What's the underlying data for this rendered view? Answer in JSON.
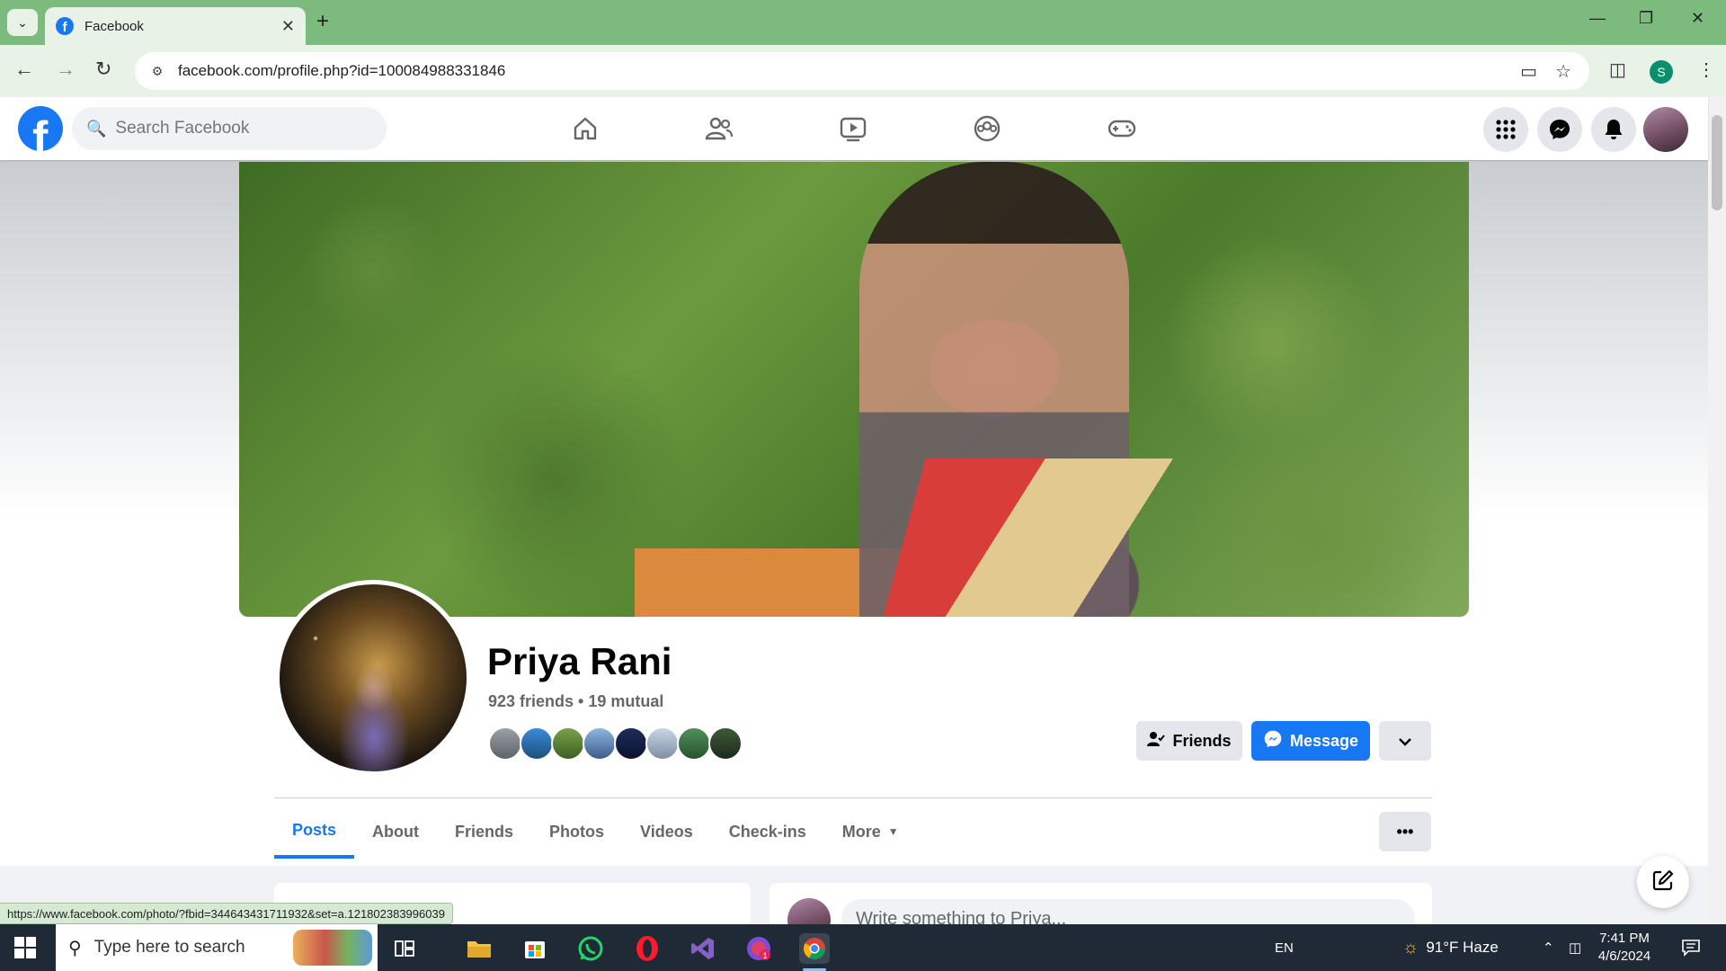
{
  "browser": {
    "tab_title": "Facebook",
    "url": "facebook.com/profile.php?id=100084988331846",
    "profile_initial": "S"
  },
  "facebook": {
    "search_placeholder": "Search Facebook",
    "logo_letter": "f"
  },
  "profile": {
    "name": "Priya Rani",
    "friends_summary": "923 friends • 19 mutual",
    "buttons": {
      "friends": "Friends",
      "message": "Message"
    },
    "tabs": [
      "Posts",
      "About",
      "Friends",
      "Photos",
      "Videos",
      "Check-ins",
      "More"
    ],
    "active_tab": "Posts",
    "composer_placeholder": "Write something to Priya..."
  },
  "status_bar": {
    "link": "https://www.facebook.com/photo/?fbid=344643431711932&set=a.121802383996039"
  },
  "taskbar": {
    "search_placeholder": "Type here to search",
    "language": "EN",
    "weather": "91°F  Haze",
    "time": "7:41 PM",
    "date": "4/6/2024"
  },
  "colors": {
    "fb_blue": "#1877f2",
    "chrome_green": "#7dba7d"
  }
}
